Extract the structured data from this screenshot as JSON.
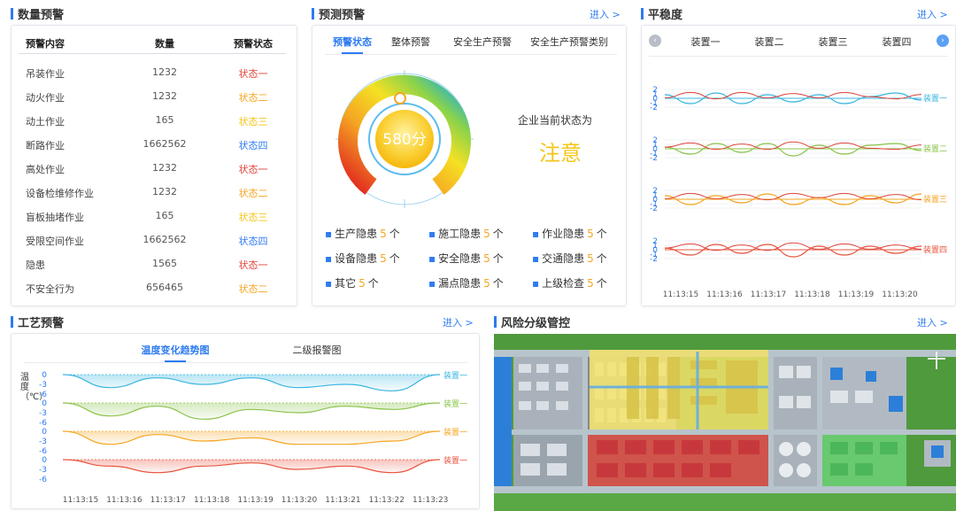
{
  "quantity_warning": {
    "title": "数量预警",
    "headers": [
      "预警内容",
      "数量",
      "预警状态"
    ],
    "rows": [
      {
        "name": "吊装作业",
        "count": "1232",
        "status": "状态一",
        "color": "#e0453a"
      },
      {
        "name": "动火作业",
        "count": "1232",
        "status": "状态二",
        "color": "#f5a623"
      },
      {
        "name": "动土作业",
        "count": "165",
        "status": "状态三",
        "color": "#f5c518"
      },
      {
        "name": "断路作业",
        "count": "1662562",
        "status": "状态四",
        "color": "#2e7bf0"
      },
      {
        "name": "高处作业",
        "count": "1232",
        "status": "状态一",
        "color": "#e0453a"
      },
      {
        "name": "设备检维修作业",
        "count": "1232",
        "status": "状态二",
        "color": "#f5a623"
      },
      {
        "name": "盲板抽堵作业",
        "count": "165",
        "status": "状态三",
        "color": "#f5c518"
      },
      {
        "name": "受限空间作业",
        "count": "1662562",
        "status": "状态四",
        "color": "#2e7bf0"
      },
      {
        "name": "隐患",
        "count": "1565",
        "status": "状态一",
        "color": "#e0453a"
      },
      {
        "name": "不安全行为",
        "count": "656465",
        "status": "状态二",
        "color": "#f5a623"
      }
    ]
  },
  "prediction": {
    "title": "预测预警",
    "enter": "进入 >",
    "tabs": [
      "预警状态",
      "整体预警",
      "安全生产预警",
      "安全生产预警类别"
    ],
    "score": "580分",
    "status_label": "企业当前状态为",
    "status_value": "注意",
    "hazards": [
      {
        "label": "生产隐患",
        "num": "5",
        "unit": "个"
      },
      {
        "label": "施工隐患",
        "num": "5",
        "unit": "个"
      },
      {
        "label": "作业隐患",
        "num": "5",
        "unit": "个"
      },
      {
        "label": "设备隐患",
        "num": "5",
        "unit": "个"
      },
      {
        "label": "安全隐患",
        "num": "5",
        "unit": "个"
      },
      {
        "label": "交通隐患",
        "num": "5",
        "unit": "个"
      },
      {
        "label": "其它",
        "num": "5",
        "unit": "个"
      },
      {
        "label": "漏点隐患",
        "num": "5",
        "unit": "个"
      },
      {
        "label": "上级检查",
        "num": "5",
        "unit": "个"
      }
    ]
  },
  "stability": {
    "title": "平稳度",
    "enter": "进入 >",
    "tabs": [
      "装置一",
      "装置二",
      "装置三",
      "装置四"
    ],
    "prev_icon": "chevron-left-icon",
    "next_icon": "chevron-right-icon"
  },
  "process": {
    "title": "工艺预警",
    "enter": "进入 >",
    "tabs": [
      "温度变化趋势图",
      "二级报警图"
    ],
    "ylabel": "温度（℃）"
  },
  "risk": {
    "title": "风险分级管控",
    "enter": "进入 >"
  },
  "chart_data": [
    {
      "type": "line",
      "title": "",
      "ylim": [
        -2,
        2
      ],
      "yticks": [
        "2",
        "1",
        "0",
        "-1",
        "-2"
      ],
      "x": [
        "11:13:15",
        "11:13:16",
        "11:13:17",
        "11:13:18",
        "11:13:19",
        "11:13:20"
      ],
      "series": [
        {
          "name": "装置一",
          "color": "#3ab6e0",
          "values": [
            0.2,
            -0.3,
            0.3,
            -0.3,
            0.2,
            -0.2,
            0.2,
            -0.3,
            0.1,
            0.3,
            -0.1
          ]
        },
        {
          "name": "装置二",
          "color": "#8bc34a",
          "values": [
            0.1,
            -0.3,
            0.3,
            -0.2,
            0.3,
            -0.4,
            0.2,
            -0.3,
            0.2,
            0.3,
            -0.1
          ]
        },
        {
          "name": "装置三",
          "color": "#f5a623",
          "values": [
            0.2,
            -0.3,
            0.2,
            -0.2,
            0.3,
            -0.3,
            0.1,
            -0.3,
            0.2,
            -0.2,
            0.3
          ]
        },
        {
          "name": "装置四",
          "color": "#e8553f",
          "values": [
            0.1,
            -0.3,
            0.3,
            -0.2,
            0.3,
            -0.4,
            0.2,
            -0.3,
            0.2,
            -0.2,
            0.2
          ]
        }
      ],
      "baseline_colors": [
        "#3ab6e0",
        "#8bc34a",
        "#f5a623",
        "#e8553f"
      ],
      "secondary_color": "#e0453a"
    },
    {
      "type": "area",
      "title": "",
      "ylabel": "温度（℃）",
      "ylim": [
        -6,
        0
      ],
      "yticks": [
        "0",
        "-3",
        "-6"
      ],
      "x": [
        "11:13:15",
        "11:13:16",
        "11:13:17",
        "11:13:18",
        "11:13:19",
        "11:13:20",
        "11:13:21",
        "11:13:22",
        "11:13:23"
      ],
      "series": [
        {
          "name": "装置一",
          "color": "#3ab6e0",
          "values": [
            0,
            -4,
            -1,
            -3,
            -1,
            -4,
            -3,
            -5,
            0
          ]
        },
        {
          "name": "装置一",
          "color": "#8bc34a",
          "values": [
            0,
            -4,
            -1,
            -5,
            -2,
            -3,
            -1,
            -2,
            0
          ]
        },
        {
          "name": "装置一",
          "color": "#f5a623",
          "values": [
            0,
            -4,
            -1,
            -3,
            -2,
            -4,
            -4,
            -3,
            0
          ]
        },
        {
          "name": "装置一",
          "color": "#e8553f",
          "values": [
            0,
            -2,
            -4,
            -2,
            -1,
            -3,
            -2,
            -4,
            0
          ]
        }
      ]
    }
  ]
}
